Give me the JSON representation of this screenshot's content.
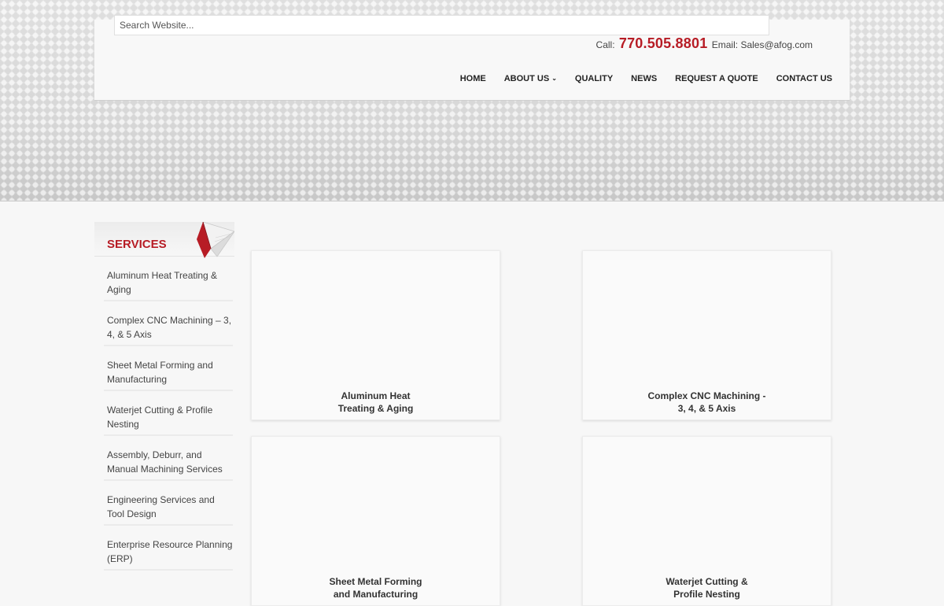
{
  "search": {
    "placeholder": "Search Website..."
  },
  "contact": {
    "call_label": "Call:",
    "phone": "770.505.8801",
    "email_label": "Email:",
    "email": "Sales@afog.com"
  },
  "nav": {
    "home": "HOME",
    "about": "ABOUT US",
    "quality": "QUALITY",
    "news": "NEWS",
    "quote": "REQUEST A QUOTE",
    "contact": "CONTACT US"
  },
  "sidebar": {
    "title": "SERVICES",
    "items": [
      {
        "label": "Aluminum Heat Treating & Aging"
      },
      {
        "label": "Complex CNC Machining – 3, 4, & 5 Axis"
      },
      {
        "label": "Sheet Metal Forming and Manufacturing"
      },
      {
        "label": "Waterjet Cutting & Profile Nesting"
      },
      {
        "label": "Assembly, Deburr, and Manual Machining Services"
      },
      {
        "label": "Engineering Services and Tool Design"
      },
      {
        "label": "Enterprise Resource Planning (ERP)"
      }
    ]
  },
  "cards": [
    {
      "label": "Aluminum Heat Treating & Aging"
    },
    {
      "label": "Complex CNC Machining - 3, 4, & 5 Axis"
    },
    {
      "label": "Sheet Metal Forming and Manufacturing"
    },
    {
      "label": "Waterjet Cutting & Profile Nesting"
    }
  ],
  "colors": {
    "accent": "#b71c25",
    "background": "#f7f7f7"
  }
}
